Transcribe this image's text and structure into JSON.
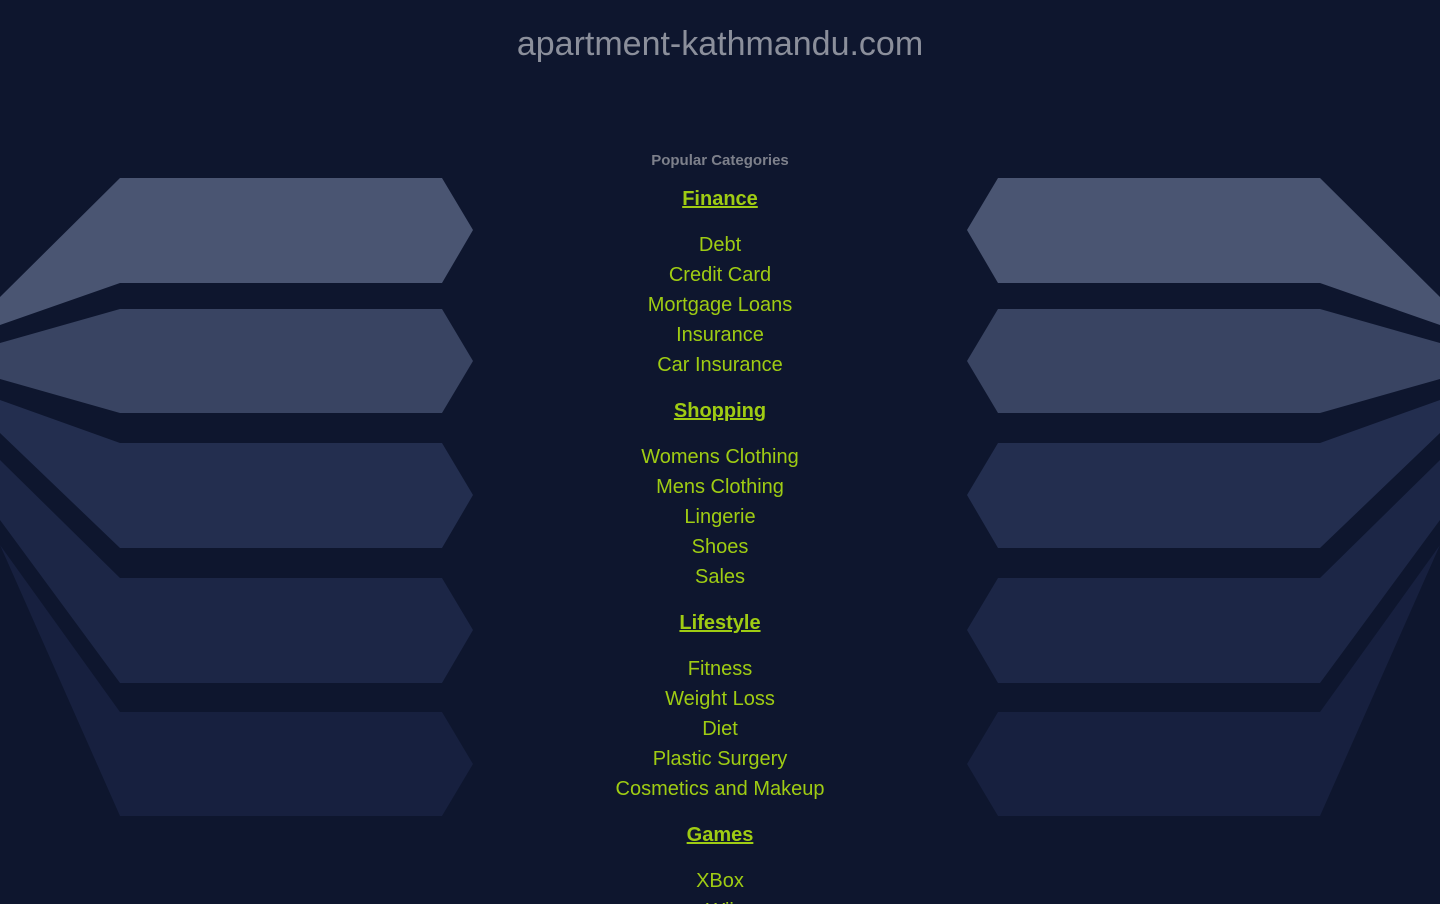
{
  "site": {
    "domain": "apartment-kathmandu.com"
  },
  "popular": {
    "label": "Popular Categories"
  },
  "colors": {
    "background": "#0e162e",
    "link": "#9fcc13",
    "title": "#8b8f9b"
  },
  "categories": [
    {
      "title": "Finance",
      "links": [
        "Debt",
        "Credit Card",
        "Mortgage Loans",
        "Insurance",
        "Car Insurance"
      ]
    },
    {
      "title": "Shopping",
      "links": [
        "Womens Clothing",
        "Mens Clothing",
        "Lingerie",
        "Shoes",
        "Sales"
      ]
    },
    {
      "title": "Lifestyle",
      "links": [
        "Fitness",
        "Weight Loss",
        "Diet",
        "Plastic Surgery",
        "Cosmetics and Makeup"
      ]
    },
    {
      "title": "Games",
      "links": [
        "XBox",
        "Wii"
      ]
    }
  ]
}
